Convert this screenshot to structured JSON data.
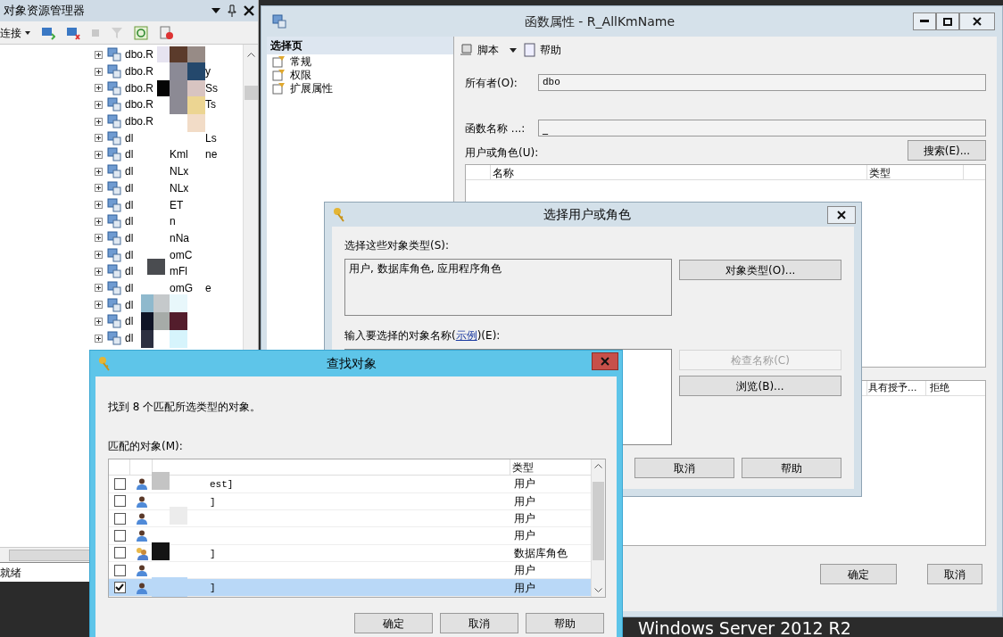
{
  "explorer": {
    "title": "对象资源管理器",
    "connect": "连接",
    "tree": [
      {
        "name": "dbo.R"
      },
      {
        "name": "dbo.R",
        "end": "y"
      },
      {
        "name": "dbo.R",
        "end": "Ss"
      },
      {
        "name": "dbo.R",
        "end": "Ts"
      },
      {
        "name": "dbo.R"
      },
      {
        "name": "dl",
        "end": "Ls"
      },
      {
        "name": "dl",
        "mid": "Kml",
        "end": "ne"
      },
      {
        "name": "dl",
        "mid": "NLx"
      },
      {
        "name": "dl",
        "mid": "NLx"
      },
      {
        "name": "dl",
        "mid": "ET"
      },
      {
        "name": "dl",
        "mid": "n"
      },
      {
        "name": "dl",
        "mid": "nNa"
      },
      {
        "name": "dl",
        "mid": "omC"
      },
      {
        "name": "dl",
        "mid": "mFl"
      },
      {
        "name": "dl",
        "mid": "omG",
        "end": "e"
      },
      {
        "name": "dl"
      },
      {
        "name": "dl"
      },
      {
        "name": "dl"
      }
    ],
    "status": "就绪"
  },
  "properties": {
    "title": "函数属性 - R_AllKmName",
    "pages_header": "选择页",
    "pages": [
      {
        "label": "常规"
      },
      {
        "label": "权限"
      },
      {
        "label": "扩展属性"
      }
    ],
    "toolbar": [
      {
        "label": "脚本",
        "kind": "dropdown"
      },
      {
        "label": "帮助",
        "kind": "plain"
      }
    ],
    "owner": {
      "label": "所有者(O):",
      "value": "dbo"
    },
    "function_name": {
      "label": "函数名称 ...:",
      "value": "_"
    },
    "users_label": "用户或角色(U):",
    "search_button": "搜索(E)...",
    "users_columns": [
      "名称",
      "类型"
    ],
    "permission_columns": [
      "具有授予...",
      "拒绝"
    ],
    "buttons": [
      "确定",
      "取消"
    ]
  },
  "select_dialog": {
    "title": "选择用户或角色",
    "types_label": "选择这些对象类型(S):",
    "types_value": "用户, 数据库角色, 应用程序角色",
    "types_button": "对象类型(O)...",
    "names_label_before": "输入要选择的对象名称(",
    "names_link": "示例",
    "names_label_after": ")(E):",
    "side_buttons": [
      {
        "label": "检查名称(C)",
        "disabled": true
      },
      {
        "label": "浏览(B)...",
        "disabled": false
      }
    ],
    "buttons": [
      "取消",
      "帮助"
    ]
  },
  "find_dialog": {
    "title": "查找对象",
    "found_text": "找到 8 个匹配所选类型的对象。",
    "list_label": "匹配的对象(M):",
    "type_column": "类型",
    "rows": [
      {
        "kind": "user",
        "name": "est]",
        "type": "用户",
        "checked": false,
        "selected": false
      },
      {
        "kind": "user",
        "name": "]",
        "type": "用户",
        "checked": false,
        "selected": false
      },
      {
        "kind": "user",
        "type": "用户",
        "checked": false,
        "selected": false
      },
      {
        "kind": "user",
        "type": "用户",
        "checked": false,
        "selected": false
      },
      {
        "kind": "role",
        "name": "]",
        "type": "数据库角色",
        "checked": false,
        "selected": false
      },
      {
        "kind": "user",
        "type": "用户",
        "checked": false,
        "selected": false
      },
      {
        "kind": "user",
        "name": "]",
        "type": "用户",
        "checked": true,
        "selected": true
      }
    ],
    "buttons": [
      "确定",
      "取消",
      "帮助"
    ]
  },
  "desktop": {
    "caption": "Windows Server 2012 R2"
  }
}
